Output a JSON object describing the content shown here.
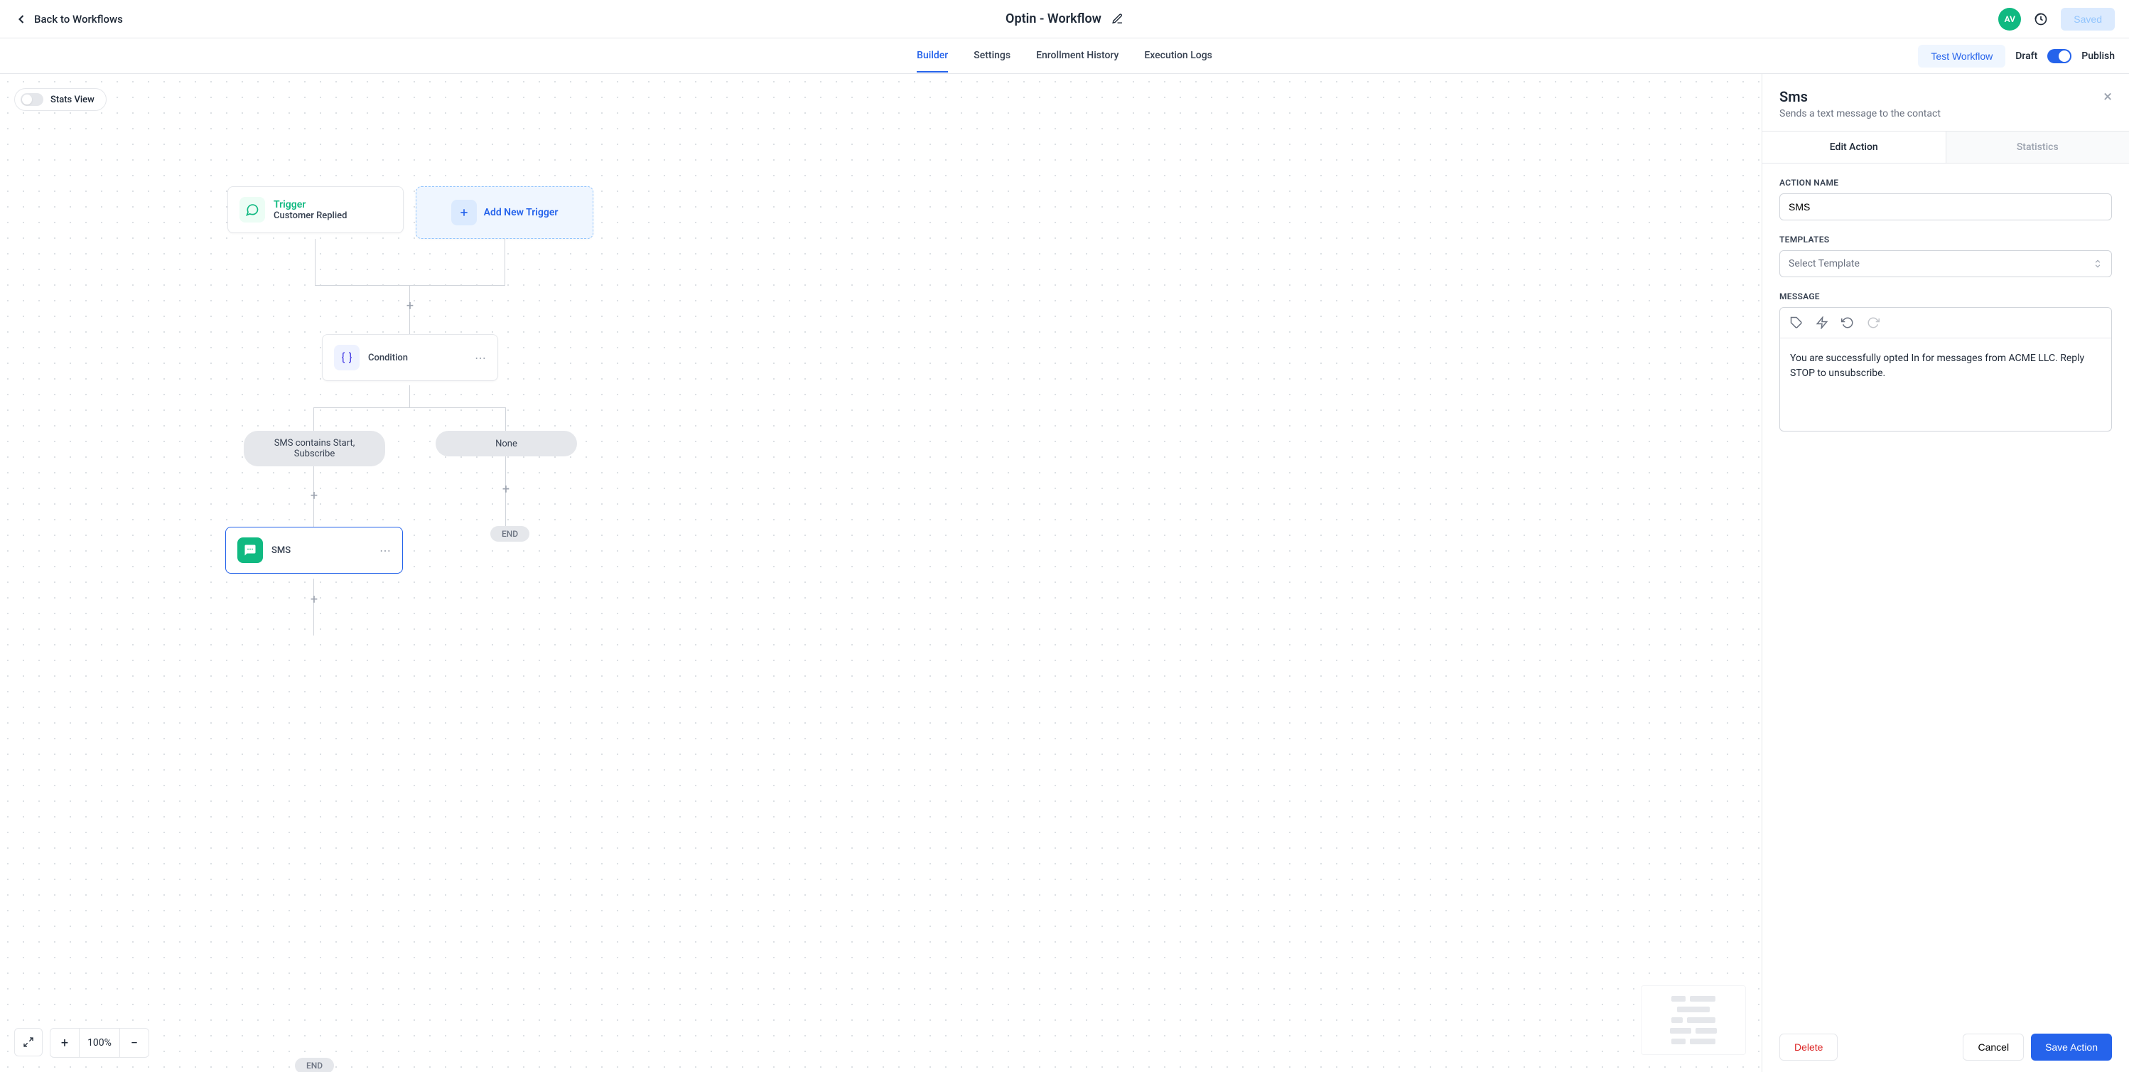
{
  "header": {
    "back_label": "Back to Workflows",
    "title": "Optin - Workflow",
    "avatar": "AV",
    "saved_label": "Saved"
  },
  "tabs": {
    "items": [
      "Builder",
      "Settings",
      "Enrollment History",
      "Execution Logs"
    ],
    "test_label": "Test Workflow",
    "draft_label": "Draft",
    "publish_label": "Publish"
  },
  "canvas": {
    "stats_view_label": "Stats View",
    "trigger": {
      "title": "Trigger",
      "subtitle": "Customer Replied"
    },
    "add_trigger_label": "Add New Trigger",
    "condition_label": "Condition",
    "branch_left": "SMS contains Start, Subscribe",
    "branch_right": "None",
    "sms_label": "SMS",
    "end_label": "END",
    "zoom_label": "100%"
  },
  "panel": {
    "title": "Sms",
    "subtitle": "Sends a text message to the contact",
    "tab_edit": "Edit Action",
    "tab_stats": "Statistics",
    "action_name_label": "ACTION NAME",
    "action_name_value": "SMS",
    "templates_label": "TEMPLATES",
    "templates_placeholder": "Select Template",
    "message_label": "MESSAGE",
    "message_text": "You are successfully opted In for messages from ACME LLC. Reply STOP to unsubscribe.",
    "delete_label": "Delete",
    "cancel_label": "Cancel",
    "save_label": "Save Action"
  }
}
